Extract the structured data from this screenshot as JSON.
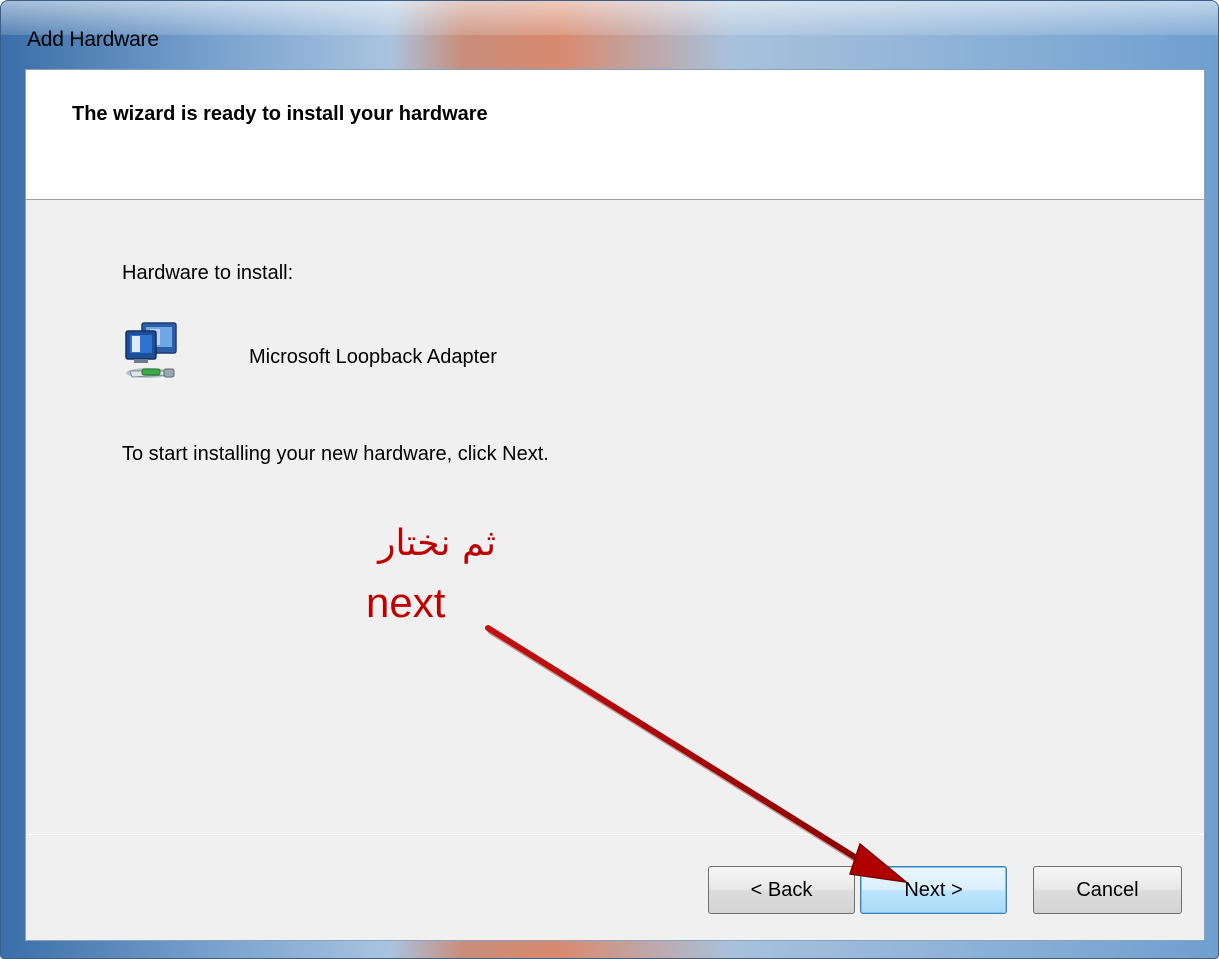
{
  "window": {
    "title": "Add Hardware"
  },
  "header": {
    "title": "The wizard is ready to install your hardware"
  },
  "content": {
    "hardware_label": "Hardware to install:",
    "device_name": "Microsoft Loopback Adapter",
    "device_icon": "network-adapter-icon",
    "instruction": "To start installing your new hardware, click Next."
  },
  "annotation": {
    "arabic_text": "ثم نختار",
    "english_text": "next",
    "color": "#c00000"
  },
  "buttons": {
    "back_label": "< Back",
    "next_label": "Next >",
    "cancel_label": "Cancel"
  }
}
